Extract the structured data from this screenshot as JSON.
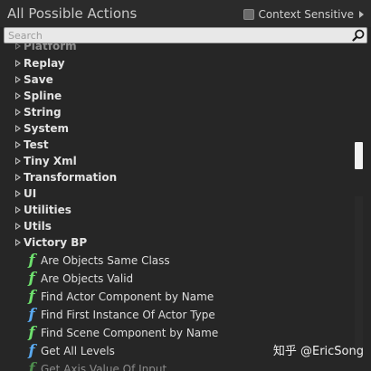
{
  "header": {
    "title": "All Possible Actions",
    "context_sensitive_label": "Context Sensitive"
  },
  "search": {
    "placeholder": "Search",
    "value": ""
  },
  "categories": [
    {
      "label": "Platform",
      "partial": true
    },
    {
      "label": "Replay"
    },
    {
      "label": "Save"
    },
    {
      "label": "Spline"
    },
    {
      "label": "String"
    },
    {
      "label": "System"
    },
    {
      "label": "Test"
    },
    {
      "label": "Tiny Xml"
    },
    {
      "label": "Transformation"
    },
    {
      "label": "UI"
    },
    {
      "label": "Utilities"
    },
    {
      "label": "Utils"
    },
    {
      "label": "Victory BP",
      "expanded": true
    }
  ],
  "actions": [
    {
      "label": "Are Objects Same Class",
      "icon": "function-pure-icon",
      "color": "#6ee06e"
    },
    {
      "label": "Are Objects Valid",
      "icon": "function-pure-icon",
      "color": "#6ee06e"
    },
    {
      "label": "Find Actor Component by Name",
      "icon": "function-pure-icon",
      "color": "#6ee06e"
    },
    {
      "label": "Find First Instance Of Actor Type",
      "icon": "function-icon",
      "color": "#5aa9ef"
    },
    {
      "label": "Find Scene Component by Name",
      "icon": "function-pure-icon",
      "color": "#6ee06e"
    },
    {
      "label": "Get All Levels",
      "icon": "function-icon",
      "color": "#5aa9ef"
    },
    {
      "label": "Get Axis Value Of Input",
      "icon": "function-pure-icon",
      "color": "#6ee06e",
      "partial": true
    }
  ],
  "watermark": "知乎 @EricSong",
  "colors": {
    "background": "#262626",
    "pure_function": "#6ee06e",
    "impure_function": "#5aa9ef"
  }
}
